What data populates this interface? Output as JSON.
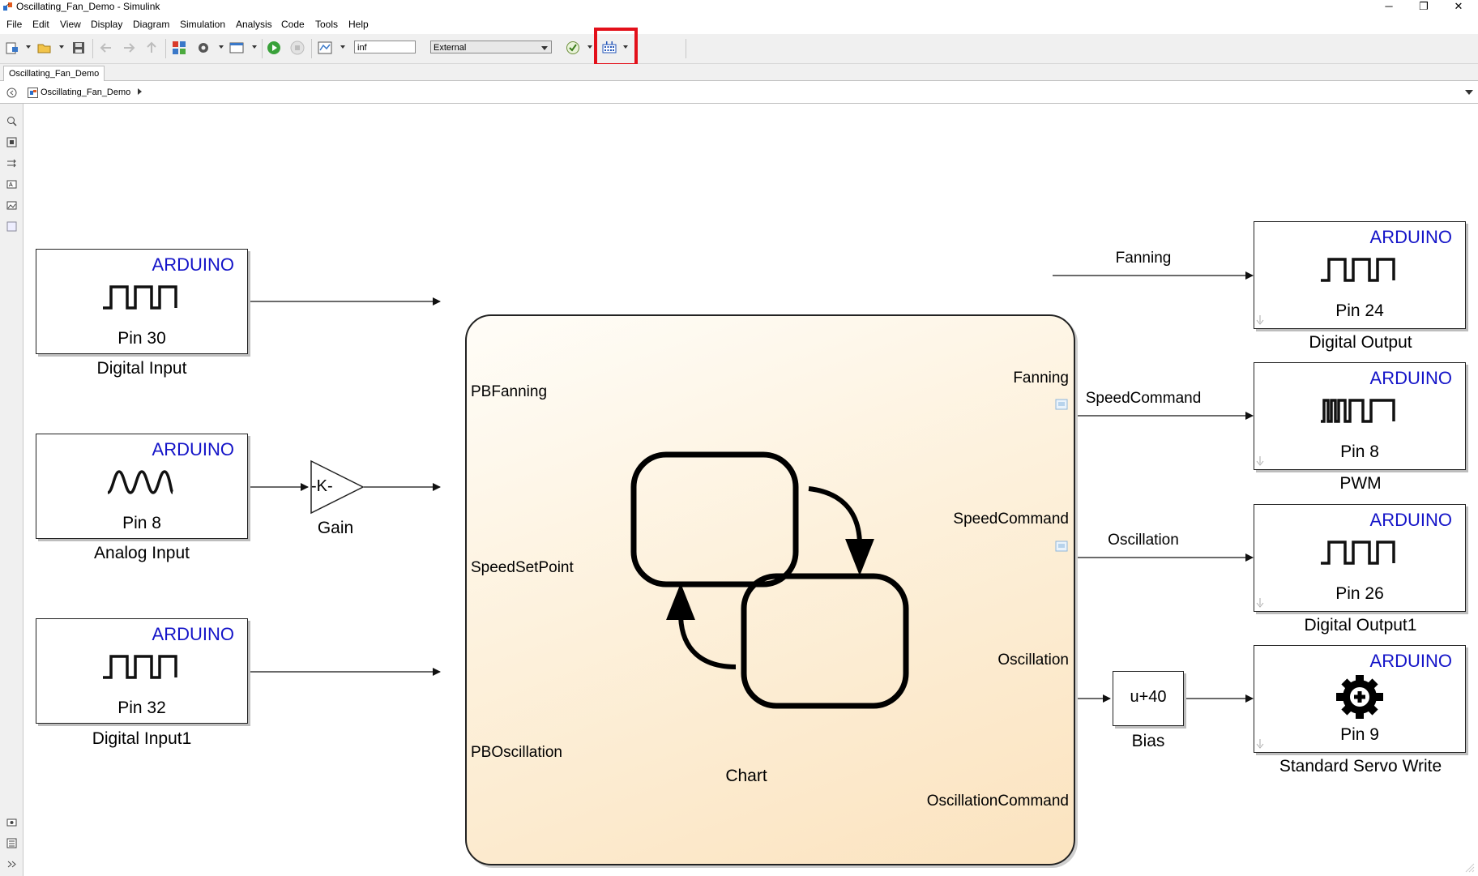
{
  "window": {
    "title": "Oscillating_Fan_Demo - Simulink",
    "minimize": "─",
    "restore": "❐",
    "close": "✕"
  },
  "menu": [
    "File",
    "Edit",
    "View",
    "Display",
    "Diagram",
    "Simulation",
    "Analysis",
    "Code",
    "Tools",
    "Help"
  ],
  "toolbar": {
    "stop_time": "inf",
    "sim_mode": "External"
  },
  "tab": {
    "label": "Oscillating_Fan_Demo"
  },
  "breadcrumb": {
    "model": "Oscillating_Fan_Demo"
  },
  "blocks": {
    "digital_input": {
      "brand": "ARDUINO",
      "pin": "Pin 30",
      "caption": "Digital Input"
    },
    "analog_input": {
      "brand": "ARDUINO",
      "pin": "Pin 8",
      "caption": "Analog Input"
    },
    "digital_input1": {
      "brand": "ARDUINO",
      "pin": "Pin 32",
      "caption": "Digital Input1"
    },
    "gain": {
      "symbol": "-K-",
      "caption": "Gain"
    },
    "chart": {
      "caption": "Chart",
      "in_ports": [
        "PBFanning",
        "SpeedSetPoint",
        "PBOscillation"
      ],
      "out_ports": [
        "Fanning",
        "SpeedCommand",
        "Oscillation",
        "OscillationCommand"
      ]
    },
    "bias": {
      "expr": "u+40",
      "caption": "Bias"
    },
    "digital_output": {
      "brand": "ARDUINO",
      "pin": "Pin 24",
      "caption": "Digital Output"
    },
    "pwm": {
      "brand": "ARDUINO",
      "pin": "Pin 8",
      "caption": "PWM"
    },
    "digital_output1": {
      "brand": "ARDUINO",
      "pin": "Pin 26",
      "caption": "Digital Output1"
    },
    "servo": {
      "brand": "ARDUINO",
      "pin": "Pin 9",
      "caption": "Standard Servo Write"
    }
  },
  "signals": {
    "fanning": "Fanning",
    "speed": "SpeedCommand",
    "osc": "Oscillation"
  },
  "colors": {
    "arduino_text": "#1414c8",
    "highlight": "#e3101a",
    "chart_fill": "#fcecd2"
  }
}
